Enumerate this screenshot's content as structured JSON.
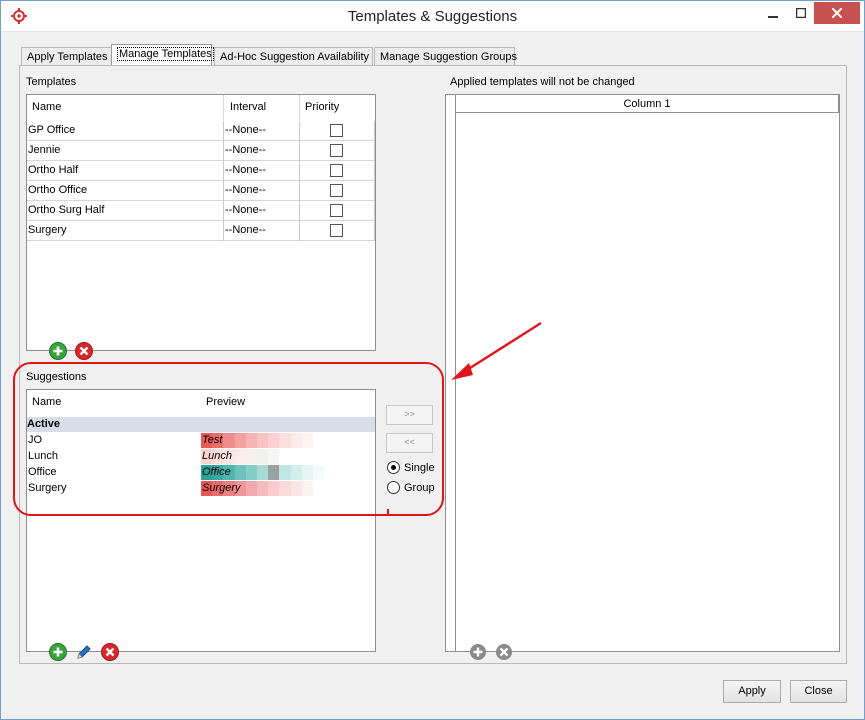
{
  "window": {
    "title": "Templates & Suggestions"
  },
  "tabs": [
    {
      "label": "Apply Templates"
    },
    {
      "label": "Manage Templates"
    },
    {
      "label": "Ad-Hoc Suggestion Availability"
    },
    {
      "label": "Manage Suggestion Groups"
    }
  ],
  "templates": {
    "label": "Templates",
    "columns": {
      "name": "Name",
      "interval": "Interval",
      "priority": "Priority"
    },
    "rows": [
      {
        "name": "GP Office",
        "interval": "--None--"
      },
      {
        "name": "Jennie",
        "interval": "--None--"
      },
      {
        "name": "Ortho Half",
        "interval": "--None--"
      },
      {
        "name": "Ortho Office",
        "interval": "--None--"
      },
      {
        "name": "Ortho Surg Half",
        "interval": "--None--"
      },
      {
        "name": "Surgery",
        "interval": "--None--"
      }
    ]
  },
  "suggestions": {
    "label": "Suggestions",
    "columns": {
      "name": "Name",
      "preview": "Preview"
    },
    "group": "Active",
    "rows": [
      {
        "name": "JO",
        "preview": "Test"
      },
      {
        "name": "Lunch",
        "preview": "Lunch"
      },
      {
        "name": "Office",
        "preview": "Office"
      },
      {
        "name": "Surgery",
        "preview": "Surgery"
      }
    ]
  },
  "transfer": {
    "add_label": ">>",
    "remove_label": "<<",
    "single_label": "Single",
    "group_label": "Group",
    "selected_mode": "Single"
  },
  "applied": {
    "label": "Applied templates will not be changed",
    "column": "Column 1"
  },
  "footer": {
    "apply_label": "Apply",
    "close_label": "Close"
  },
  "colors": {
    "annotation": "#e0161b",
    "add": "#3aa43a",
    "delete": "#d9262a",
    "edit": "#2a6fc9"
  },
  "icons": {
    "app": "target-icon",
    "add": "plus-circle-icon",
    "delete": "x-circle-icon",
    "edit": "pencil-icon"
  }
}
